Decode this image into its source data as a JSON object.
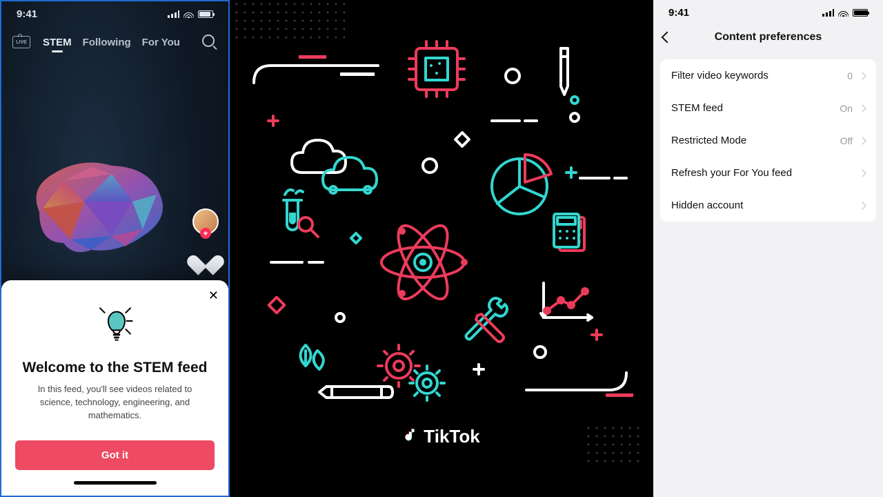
{
  "left": {
    "status_time": "9:41",
    "live_label": "LIVE",
    "tabs": {
      "stem": "STEM",
      "following": "Following",
      "foryou": "For You"
    },
    "sheet": {
      "title": "Welcome to the STEM feed",
      "body": "In this feed, you'll see videos related to science, technology, engineering, and mathematics.",
      "cta": "Got it"
    }
  },
  "middle": {
    "brand": "TikTok"
  },
  "right": {
    "status_time": "9:41",
    "title": "Content preferences",
    "rows": [
      {
        "label": "Filter video keywords",
        "value": "0"
      },
      {
        "label": "STEM feed",
        "value": "On"
      },
      {
        "label": "Restricted Mode",
        "value": "Off"
      },
      {
        "label": "Refresh your For You feed",
        "value": ""
      },
      {
        "label": "Hidden account",
        "value": ""
      }
    ]
  }
}
